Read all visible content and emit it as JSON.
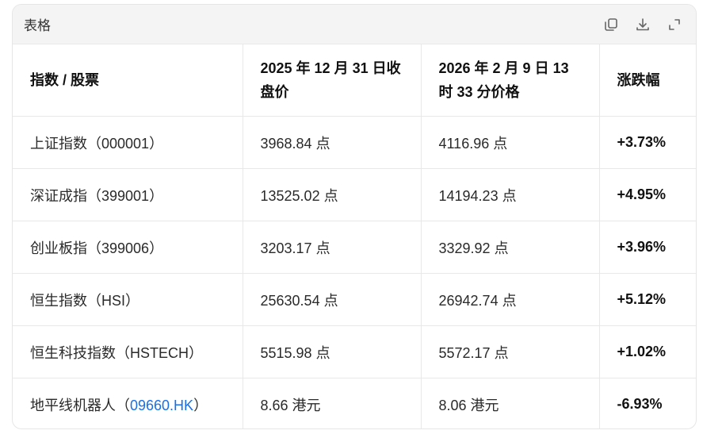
{
  "card": {
    "title": "表格",
    "toolbar": {
      "copy_icon": "copy-icon",
      "download_icon": "download-icon",
      "expand_icon": "expand-icon"
    }
  },
  "table": {
    "headers": [
      "指数 / 股票",
      "2025 年 12 月 31 日收盘价",
      "2026 年 2 月 9 日 13 时 33 分价格",
      "涨跌幅"
    ],
    "rows": [
      {
        "name": "上证指数",
        "code": "000001",
        "close": "3968.84 点",
        "price": "4116.96 点",
        "change": "+3.73%"
      },
      {
        "name": "深证成指",
        "code": "399001",
        "close": "13525.02 点",
        "price": "14194.23 点",
        "change": "+4.95%"
      },
      {
        "name": "创业板指",
        "code": "399006",
        "close": "3203.17 点",
        "price": "3329.92 点",
        "change": "+3.96%"
      },
      {
        "name": "恒生指数",
        "code": "HSI",
        "close": "25630.54 点",
        "price": "26942.74 点",
        "change": "+5.12%"
      },
      {
        "name": "恒生科技指数",
        "code": "HSTECH",
        "close": "5515.98 点",
        "price": "5572.17 点",
        "change": "+1.02%"
      },
      {
        "name": "地平线机器人",
        "code": "09660.HK",
        "close": "8.66 港元",
        "price": "8.06 港元",
        "change": "-6.93%"
      }
    ]
  },
  "colors": {
    "link": "#1a6ee8",
    "header_bg": "#f4f4f5",
    "border": "#e8e8e8"
  }
}
